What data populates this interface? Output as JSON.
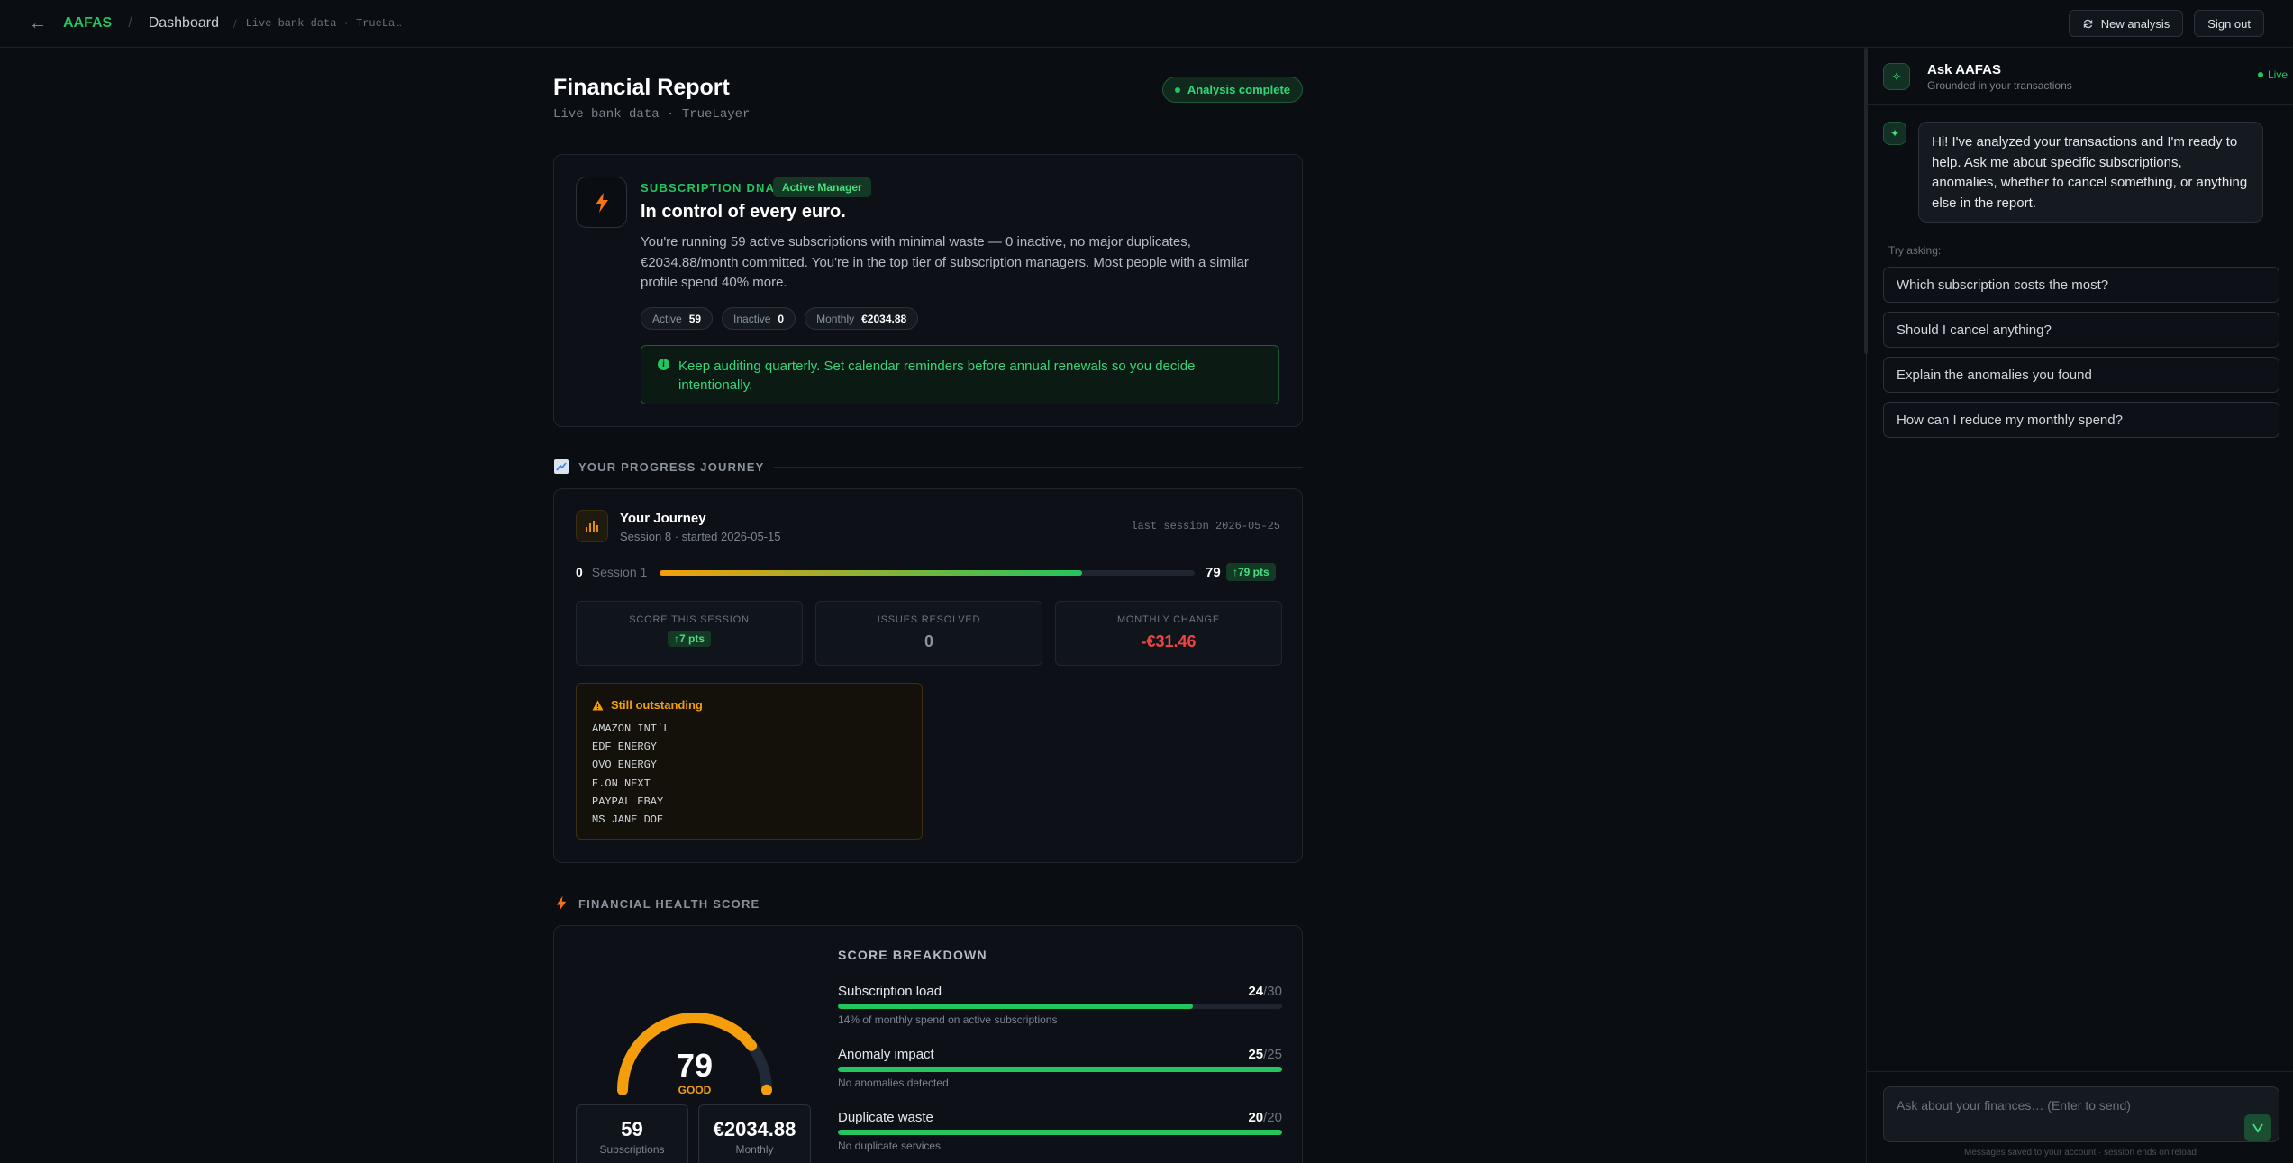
{
  "topbar": {
    "brand": "AAFAS",
    "crumb": "Dashboard",
    "crumb_sub": "Live bank data · TrueLa…",
    "new_analysis": "New analysis",
    "sign_out": "Sign out"
  },
  "report": {
    "title": "Financial Report",
    "subtitle": "Live bank data · TrueLayer",
    "status": "Analysis complete"
  },
  "dna": {
    "label": "SUBSCRIPTION DNA",
    "badge": "Active Manager",
    "headline": "In control of every euro.",
    "description": "You're running 59 active subscriptions with minimal waste — 0 inactive, no major duplicates, €2034.88/month committed. You're in the top tier of subscription managers. Most people with a similar profile spend 40% more.",
    "stats": [
      {
        "label": "Active",
        "value": "59"
      },
      {
        "label": "Inactive",
        "value": "0"
      },
      {
        "label": "Monthly",
        "value": "€2034.88"
      }
    ],
    "tip": "Keep auditing quarterly. Set calendar reminders before annual renewals so you decide intentionally."
  },
  "progress_section": {
    "title": "YOUR PROGRESS JOURNEY"
  },
  "journey": {
    "title": "Your Journey",
    "subtitle": "Session 8 · started 2026-05-15",
    "last_session": "last session 2026-05-25",
    "start_value": "0",
    "start_label": "Session 1",
    "end_value": "79",
    "gain": "↑79 pts",
    "progress_fraction": 0.79,
    "metrics": [
      {
        "label": "SCORE THIS SESSION",
        "value": "↑7 pts"
      },
      {
        "label": "ISSUES RESOLVED",
        "value": "0"
      },
      {
        "label": "MONTHLY CHANGE",
        "value": "-€31.46"
      }
    ],
    "outstanding_title": "Still outstanding",
    "outstanding": [
      "AMAZON INT'L",
      "EDF ENERGY",
      "OVO ENERGY",
      "E.ON NEXT",
      "PAYPAL EBAY",
      "MS JANE DOE"
    ]
  },
  "health_section": {
    "title": "FINANCIAL HEALTH SCORE"
  },
  "health": {
    "score": "79",
    "score_fraction": 0.79,
    "rating": "GOOD",
    "subscriptions_value": "59",
    "subscriptions_label": "Subscriptions",
    "monthly_value": "€2034.88",
    "monthly_label": "Monthly",
    "breakdown_title": "SCORE BREAKDOWN",
    "breakdown": [
      {
        "name": "Subscription load",
        "score": "24",
        "max": "/30",
        "fraction": 0.8,
        "desc": "14% of monthly spend on active subscriptions"
      },
      {
        "name": "Anomaly impact",
        "score": "25",
        "max": "/25",
        "fraction": 1.0,
        "desc": "No anomalies detected"
      },
      {
        "name": "Duplicate waste",
        "score": "20",
        "max": "/20",
        "fraction": 1.0,
        "desc": "No duplicate services"
      }
    ]
  },
  "chat": {
    "title": "Ask AAFAS",
    "subtitle": "Grounded in your transactions",
    "live": "Live",
    "greeting": "Hi! I've analyzed your transactions and I'm ready to help. Ask me about specific subscriptions, anomalies, whether to cancel something, or anything else in the report.",
    "try_label": "Try asking:",
    "suggestions": [
      "Which subscription costs the most?",
      "Should I cancel anything?",
      "Explain the anomalies you found",
      "How can I reduce my monthly spend?"
    ],
    "placeholder": "Ask about your finances… (Enter to send)",
    "footnote": "Messages saved to your account · session ends on reload"
  },
  "colors": {
    "accent": "#22c55e",
    "warning": "#f59e0b",
    "danger": "#ef4444"
  }
}
